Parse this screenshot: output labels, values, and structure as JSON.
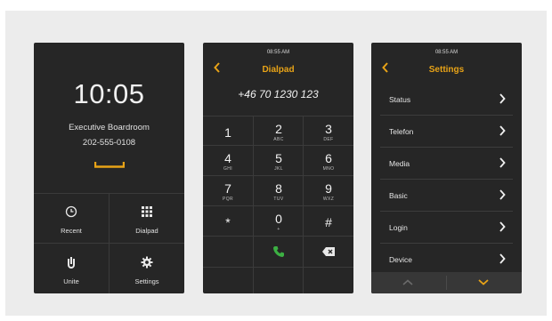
{
  "colors": {
    "accent": "#e8a317",
    "call_green": "#3cb043",
    "panel_bg": "#262626",
    "stage_bg": "#ececec"
  },
  "home": {
    "time": "10:05",
    "room_name": "Executive Boardroom",
    "extension": "202-555-0108",
    "tiles": [
      {
        "label": "Recent",
        "icon": "recent-clock-icon"
      },
      {
        "label": "Dialpad",
        "icon": "dialpad-grid-icon"
      },
      {
        "label": "Unite",
        "icon": "unite-icon"
      },
      {
        "label": "Settings",
        "icon": "gear-icon"
      }
    ]
  },
  "dialpad": {
    "status_time": "08:55 AM",
    "title": "Dialpad",
    "number": "+46 70 1230 123",
    "keys": [
      {
        "digit": "1",
        "sub": ""
      },
      {
        "digit": "2",
        "sub": "ABC"
      },
      {
        "digit": "3",
        "sub": "DEF"
      },
      {
        "digit": "4",
        "sub": "GHI"
      },
      {
        "digit": "5",
        "sub": "JKL"
      },
      {
        "digit": "6",
        "sub": "MNO"
      },
      {
        "digit": "7",
        "sub": "PQR"
      },
      {
        "digit": "8",
        "sub": "TUV"
      },
      {
        "digit": "9",
        "sub": "WXZ"
      },
      {
        "digit": "*",
        "sub": ""
      },
      {
        "digit": "0",
        "sub": "+"
      },
      {
        "digit": "#",
        "sub": ""
      }
    ]
  },
  "settings": {
    "status_time": "08:55 AM",
    "title": "Settings",
    "items": [
      "Status",
      "Telefon",
      "Media",
      "Basic",
      "Login",
      "Device"
    ]
  }
}
